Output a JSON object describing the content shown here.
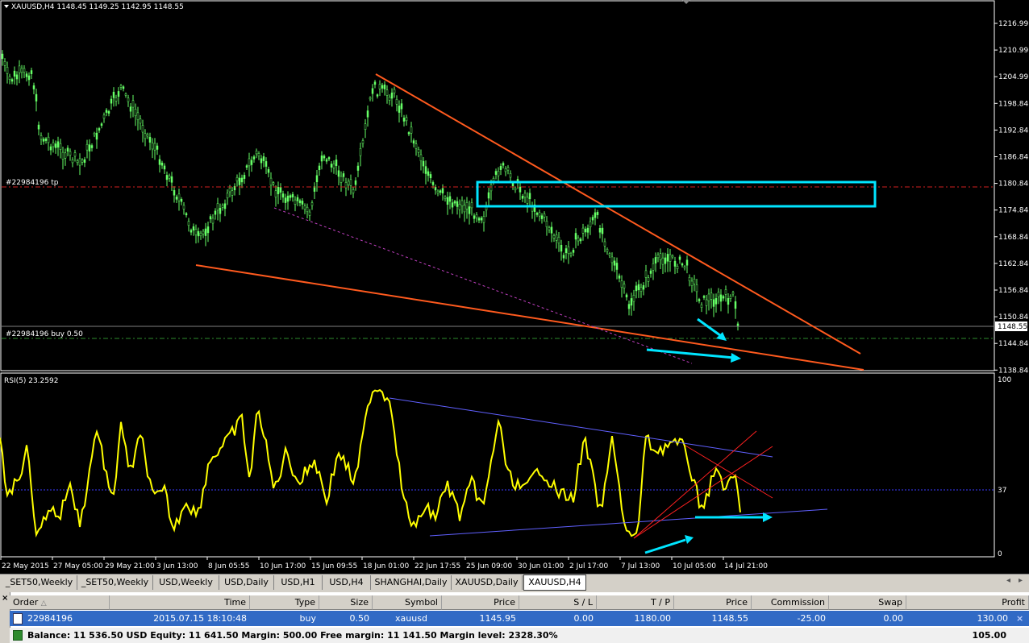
{
  "chart": {
    "header": "XAUUSD,H4  1148.45  1149.25  1142.95  1148.55",
    "price_labels": [
      "1216.99",
      "1210.99",
      "1204.99",
      "1198.84",
      "1192.84",
      "1186.84",
      "1180.84",
      "1174.84",
      "1168.84",
      "1162.84",
      "1156.84",
      "1150.84",
      "1144.84",
      "1138.84"
    ],
    "current_price": "1148.55",
    "tp_label": "#22984196 tp",
    "order_label": "#22984196 buy 0.50",
    "rsi_label": "RSI(5) 23.2592",
    "rsi_levels": [
      "100",
      "37",
      "0"
    ],
    "time_labels": [
      "22 May 2015",
      "27 May 05:00",
      "29 May 21:00",
      "3 Jun 13:00",
      "8 Jun 05:55",
      "10 Jun 17:00",
      "15 Jun 09:55",
      "18 Jun 01:00",
      "22 Jun 17:55",
      "25 Jun 09:00",
      "30 Jun 01:00",
      "2 Jul 17:00",
      "7 Jul 13:00",
      "10 Jul 05:00",
      "14 Jul 21:00"
    ],
    "colors": {
      "candle": "#66ff66",
      "trendline": "#ff5a1e",
      "rectangle": "#00e5ff",
      "rsi": "#ffff00",
      "rsi_trendline": "#6060ff",
      "tp_line": "#d02020",
      "order_line": "#2e8b2e",
      "fan": "#ff2020",
      "dotted": "#c040c0"
    }
  },
  "tabs": [
    "_SET50,Weekly",
    "_SET50,Weekly",
    "USD,Weekly",
    "USD,Daily",
    "USD,H1",
    "USD,H4",
    "SHANGHAI,Daily",
    "XAUUSD,Daily",
    "XAUUSD,H4"
  ],
  "terminal": {
    "headers": [
      "Order",
      "Time",
      "Type",
      "Size",
      "Symbol",
      "Price",
      "S / L",
      "T / P",
      "Price",
      "Commission",
      "Swap",
      "Profit"
    ],
    "rows": [
      {
        "order": "22984196",
        "time": "2015.07.15 18:10:48",
        "type": "buy",
        "size": "0.50",
        "symbol": "xauusd",
        "price": "1145.95",
        "sl": "0.00",
        "tp": "1180.00",
        "cur_price": "1148.55",
        "commission": "-25.00",
        "swap": "0.00",
        "profit": "130.00"
      }
    ],
    "balance_text": "Balance: 11 536.50 USD  Equity: 11 641.50  Margin: 500.00  Free margin: 11 141.50  Margin level: 2328.30%",
    "balance_profit": "105.00"
  }
}
